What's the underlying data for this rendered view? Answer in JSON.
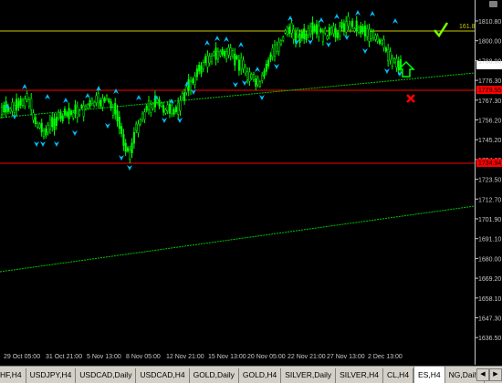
{
  "price_axis": {
    "labels": [
      "1810.80",
      "1800.00",
      "1788.00",
      "1776.30",
      "1767.30",
      "1756.20",
      "1745.20",
      "1734.60",
      "1723.50",
      "1712.70",
      "1701.90",
      "1691.10",
      "1680.00",
      "1669.20",
      "1658.10",
      "1647.30",
      "1636.50"
    ],
    "marker_upper": "1779.55",
    "marker_lower": "1734.94",
    "fib_level": "161.8"
  },
  "time_axis": {
    "labels": [
      "29 Oct 05:00",
      "31 Oct 21:00",
      "5 Nov 13:00",
      "8 Nov 05:00",
      "12 Nov 21:00",
      "15 Nov 13:00",
      "20 Nov 05:00",
      "22 Nov 21:00",
      "27 Nov 13:00",
      "2 Dec 13:00"
    ]
  },
  "colors": {
    "candle": "#00ff00",
    "arrow": "#00bfff",
    "fib_line": "#c8c800",
    "trendline": "#00c800",
    "support_red": "#ff0000",
    "check": "#7cfc00",
    "cross": "#ff0000",
    "up_arrow": "#00ff00"
  },
  "icons": [
    "check-icon",
    "cross-icon",
    "up-arrow-icon"
  ],
  "tabs": [
    {
      "label": "HF,H4"
    },
    {
      "label": "USDJPY,H4"
    },
    {
      "label": "USDCAD,Daily"
    },
    {
      "label": "USDCAD,H4"
    },
    {
      "label": "GOLD,Daily"
    },
    {
      "label": "GOLD,H4"
    },
    {
      "label": "SILVER,Daily"
    },
    {
      "label": "SILVER,H4"
    },
    {
      "label": "CL,H4"
    },
    {
      "label": "ES,H4",
      "active": true
    },
    {
      "label": "NG,Daily"
    }
  ]
}
